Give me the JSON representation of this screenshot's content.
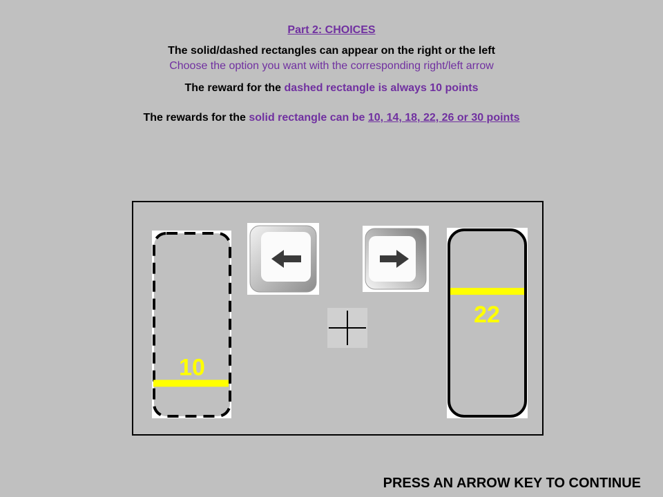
{
  "instructions": {
    "title": "Part 2: CHOICES",
    "line1": "The solid/dashed rectangles can appear on the right or the left",
    "line2": "Choose the option  you want with the corresponding right/left arrow",
    "line3_prefix": "The reward for the ",
    "line3_highlight": "dashed rectangle is always 10 points",
    "line4_prefix": "The rewards for the ",
    "line4_highlight": "solid rectangle can be ",
    "line4_values": "10, 14, 18, 22, 26 or 30 points"
  },
  "left_option": {
    "style": "dashed",
    "reward_label": "10",
    "level_fraction": 0.18
  },
  "right_option": {
    "style": "solid",
    "reward_label": "22",
    "level_fraction": 0.67
  },
  "keys": {
    "left": "left-arrow-icon",
    "right": "right-arrow-icon"
  },
  "fixation": "+",
  "footer": {
    "continue_text": "PRESS AN ARROW KEY TO CONTINUE"
  },
  "colors": {
    "background": "#c0c0c0",
    "accent": "#7030a0",
    "reward_bar": "#ffff00"
  }
}
